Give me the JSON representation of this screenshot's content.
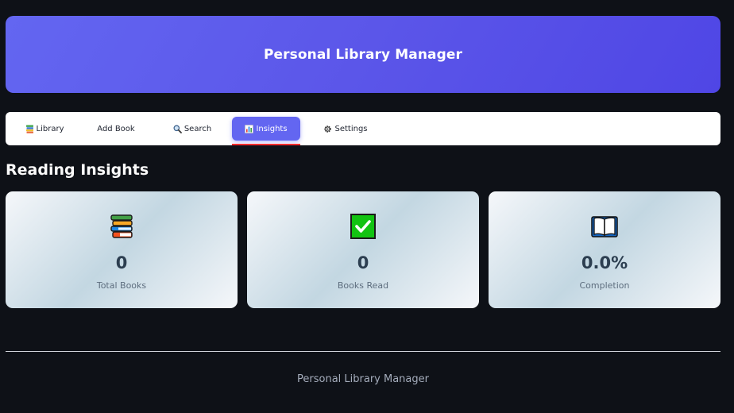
{
  "header": {
    "title": "Personal Library Manager"
  },
  "tabs": [
    {
      "label": "Library",
      "icon": "books-icon"
    },
    {
      "label": "Add Book",
      "icon": ""
    },
    {
      "label": "Search",
      "icon": "magnifier-icon"
    },
    {
      "label": "Insights",
      "icon": "bar-chart-icon",
      "active": true
    },
    {
      "label": "Settings",
      "icon": "gear-icon"
    }
  ],
  "section": {
    "title": "Reading Insights"
  },
  "cards": [
    {
      "icon": "books-stack-icon",
      "value": "0",
      "label": "Total Books"
    },
    {
      "icon": "check-mark-icon",
      "value": "0",
      "label": "Books Read"
    },
    {
      "icon": "open-book-icon",
      "value": "0.0%",
      "label": "Completion"
    }
  ],
  "footer": {
    "text": "Personal Library Manager"
  },
  "colors": {
    "background": "#0e1117",
    "accent": "#6366f1",
    "active_underline": "#ff2b2b",
    "card_value": "#2c3e50"
  }
}
